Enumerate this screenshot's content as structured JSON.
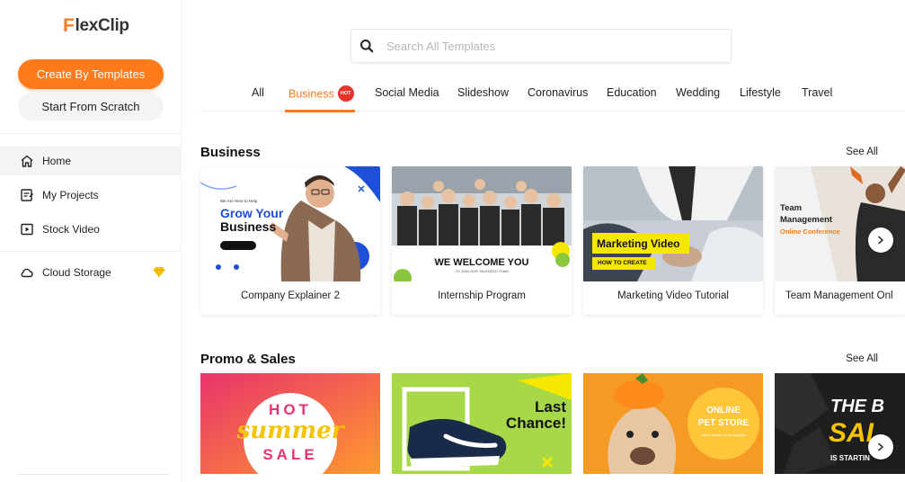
{
  "app": {
    "logo_text": "lexClip",
    "logo_mark": "F"
  },
  "sidebar": {
    "create_button": "Create By Templates",
    "scratch_button": "Start From Scratch",
    "items": [
      {
        "label": "Home",
        "icon": "home-icon"
      },
      {
        "label": "My Projects",
        "icon": "projects-icon"
      },
      {
        "label": "Stock Video",
        "icon": "video-icon"
      },
      {
        "label": "Cloud Storage",
        "icon": "cloud-icon"
      }
    ]
  },
  "search": {
    "placeholder": "Search All Templates",
    "value": ""
  },
  "tabs": [
    {
      "label": "All"
    },
    {
      "label": "Business",
      "badge": "HOT"
    },
    {
      "label": "Social Media"
    },
    {
      "label": "Slideshow"
    },
    {
      "label": "Coronavirus"
    },
    {
      "label": "Education"
    },
    {
      "label": "Wedding"
    },
    {
      "label": "Lifestyle"
    },
    {
      "label": "Travel"
    }
  ],
  "sections": {
    "business": {
      "title": "Business",
      "see_all": "See All",
      "cards": [
        {
          "label": "Company Explainer 2",
          "thumb": {
            "small": "We Are Here to Help",
            "line1": "Grow Your",
            "line2": "Business"
          }
        },
        {
          "label": "Internship Program",
          "thumb": {
            "heading": "WE WELCOME YOU",
            "sub": "TO JOIN OUR TALENTED TEAM"
          }
        },
        {
          "label": "Marketing Video Tutorial",
          "thumb": {
            "heading": "Marketing Video",
            "sub": "HOW TO CREATE"
          }
        },
        {
          "label": "Team Management Onl",
          "thumb": {
            "line1": "Team",
            "line2": "Management",
            "line3": "Online Conference"
          }
        }
      ]
    },
    "promo": {
      "title": "Promo & Sales",
      "see_all": "See All",
      "cards": [
        {
          "thumb": {
            "top": "HOT",
            "mid": "summer",
            "bottom": "SALE"
          }
        },
        {
          "thumb": {
            "line1": "Last",
            "line2": "Chance!"
          }
        },
        {
          "thumb": {
            "line1": "ONLINE",
            "line2": "PET STORE",
            "sub": "with a variety of pet supplies"
          }
        },
        {
          "thumb": {
            "line1": "THE B",
            "line2": "SAL",
            "sub": "IS STARTIN"
          }
        }
      ]
    }
  },
  "colors": {
    "accent": "#ff7a1a",
    "hot_badge": "#e8332b",
    "marketing_yellow": "#f5e700"
  }
}
